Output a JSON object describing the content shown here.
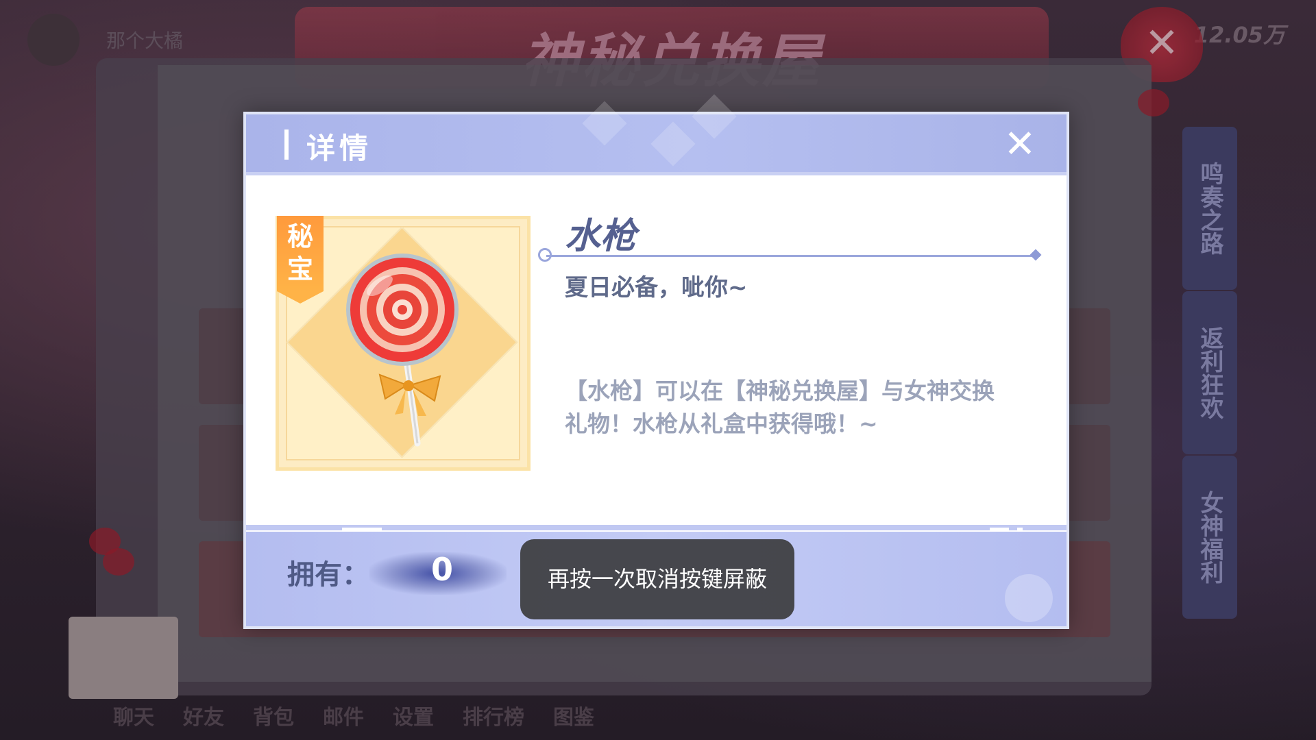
{
  "background": {
    "banner_title": "神秘兑换屋",
    "username": "那个大橘",
    "coins": "12.05万",
    "side_tabs": [
      "鸣奏之路",
      "返利狂欢",
      "女神福利"
    ],
    "nav_items": [
      "聊天",
      "好友",
      "背包",
      "邮件",
      "设置",
      "排行榜",
      "图鉴"
    ]
  },
  "dialog": {
    "header_title": "详情",
    "close_icon": "close-icon",
    "item": {
      "badge": "秘宝",
      "icon": "lollipop-icon",
      "name": "水枪",
      "tagline": "夏日必备，呲你~",
      "description": "【水枪】可以在【神秘兑换屋】与女神交换礼物！水枪从礼盒中获得哦！~"
    },
    "footer": {
      "owned_label": "拥有：",
      "owned_value": "0"
    }
  },
  "toast": {
    "message": "再按一次取消按键屏蔽"
  },
  "colors": {
    "header": "#aab4ea",
    "footer": "#c3cbf5",
    "badge": "#ff9a3c",
    "toast_bg": "#3c3c3e"
  }
}
